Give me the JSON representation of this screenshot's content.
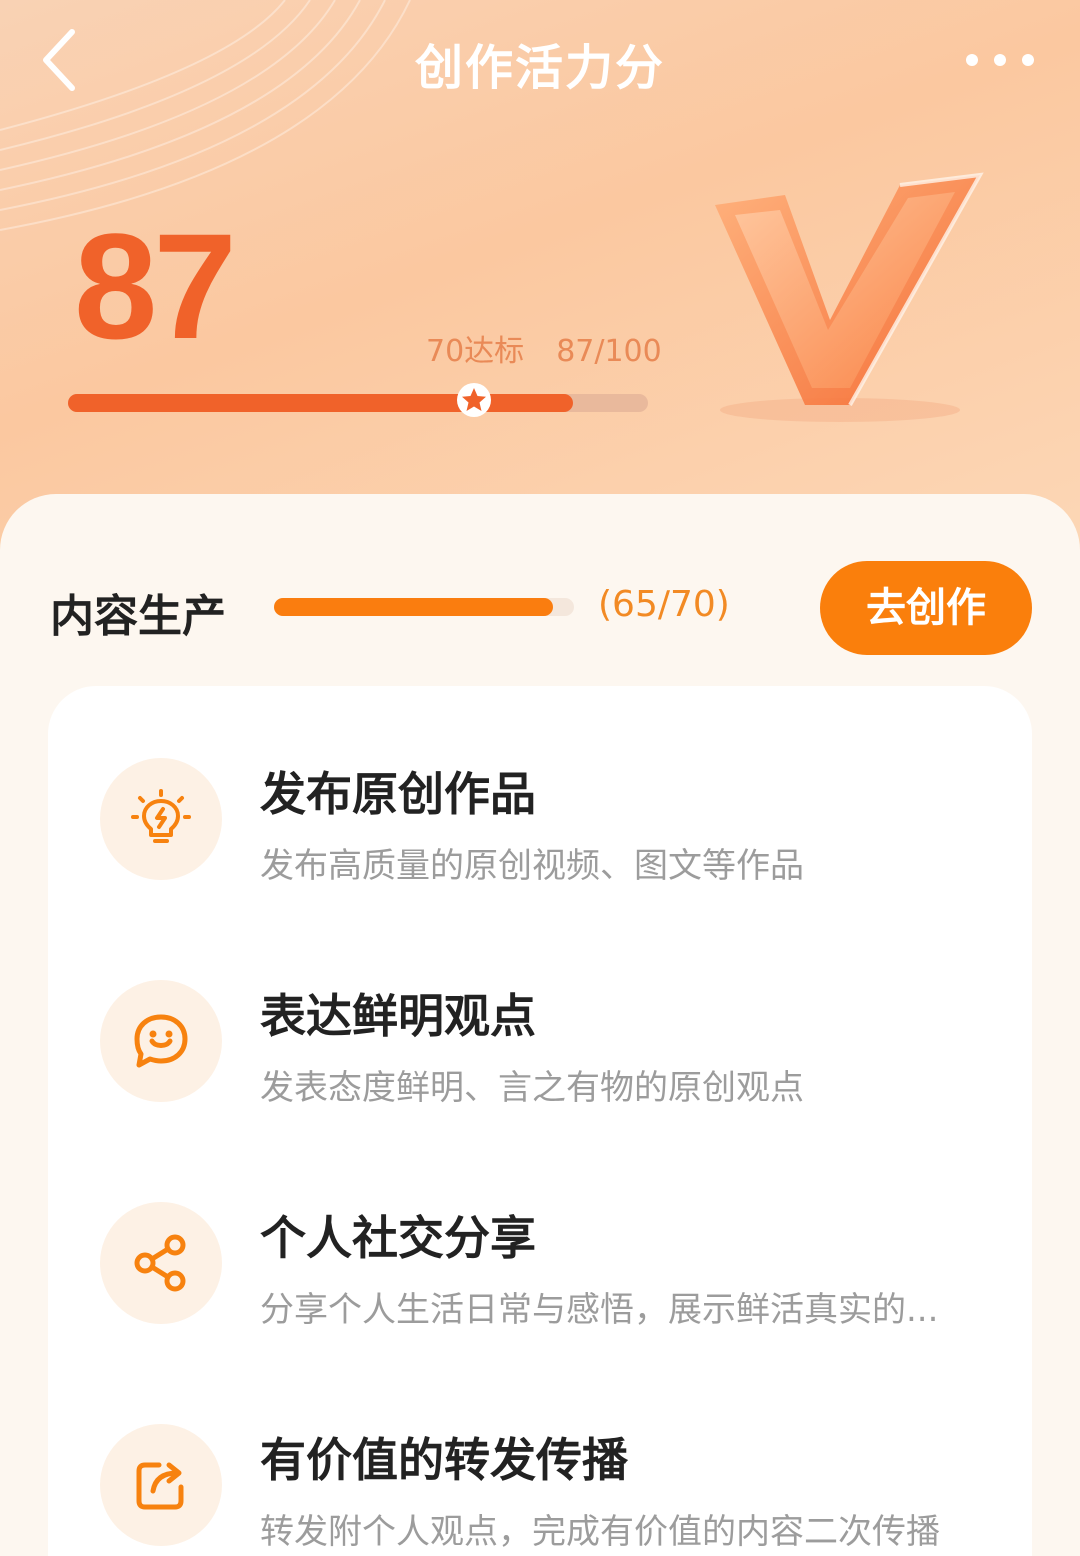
{
  "nav": {
    "title": "创作活力分"
  },
  "score": {
    "value": "87",
    "standard_label": "70达标",
    "progress_label": "87/100",
    "progress_fraction": 0.87,
    "standard_fraction": 0.7
  },
  "section": {
    "title": "内容生产",
    "count": "(65/70)",
    "progress_fraction": 0.9286,
    "button_label": "去创作"
  },
  "tasks": [
    {
      "title": "发布原创作品",
      "desc": "发布高质量的原创视频、图文等作品",
      "icon": "lightbulb-icon"
    },
    {
      "title": "表达鲜明观点",
      "desc": "发表态度鲜明、言之有物的原创观点",
      "icon": "chat-smile-icon"
    },
    {
      "title": "个人社交分享",
      "desc": "分享个人生活日常与感悟，展示鲜活真实的...",
      "icon": "share-icon"
    },
    {
      "title": "有价值的转发传播",
      "desc": "转发附个人观点，完成有价值的内容二次传播",
      "icon": "repost-icon"
    }
  ],
  "colors": {
    "accent": "#f0622a",
    "button": "#fa7f0c",
    "progress": "#fa7d0f",
    "icon_bg": "#fdf1e5"
  }
}
